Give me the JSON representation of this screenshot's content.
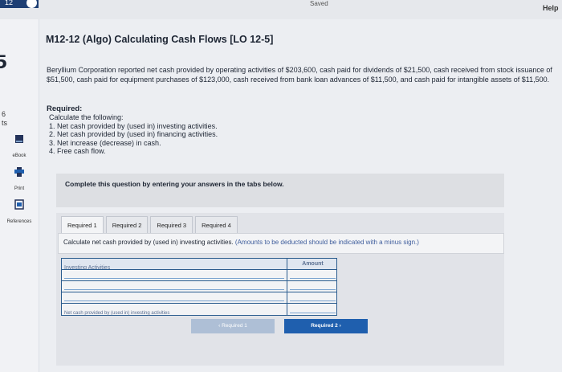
{
  "header": {
    "status": "Saved",
    "help": "Help",
    "corner_text": "12"
  },
  "sidebar": {
    "question_number": "5",
    "points_value": "6",
    "points_label": "ts",
    "items": [
      {
        "label": "eBook",
        "icon": "ebook-icon"
      },
      {
        "label": "Print",
        "icon": "printer-icon"
      },
      {
        "label": "References",
        "icon": "references-icon"
      }
    ]
  },
  "question": {
    "title": "M12-12 (Algo) Calculating Cash Flows [LO 12-5]",
    "body": "Beryllium Corporation reported net cash provided by operating activities of $203,600, cash paid for dividends of $21,500, cash received from stock issuance of $51,500, cash paid for equipment purchases of $123,000, cash received from bank loan advances of $11,500, and cash paid for intangible assets of $11,500.",
    "required_heading": "Required:",
    "required_intro": "Calculate the following:",
    "required_items": [
      "1. Net cash provided by (used in) investing activities.",
      "2. Net cash provided by (used in) financing activities.",
      "3. Net increase (decrease) in cash.",
      "4. Free cash flow."
    ]
  },
  "banner": {
    "text": "Complete this question by entering your answers in the tabs below."
  },
  "tabs": [
    {
      "label": "Required 1",
      "active": true
    },
    {
      "label": "Required 2",
      "active": false
    },
    {
      "label": "Required 3",
      "active": false
    },
    {
      "label": "Required 4",
      "active": false
    }
  ],
  "instructions": {
    "main": "Calculate net cash provided by (used in) investing activities.",
    "note": "(Amounts to be deducted should be indicated with a minus sign.)"
  },
  "table": {
    "header_label": "Investing Activities",
    "header_amount": "Amount",
    "rows": [
      {
        "label": "",
        "amount": ""
      },
      {
        "label": "",
        "amount": ""
      },
      {
        "label": "",
        "amount": ""
      }
    ],
    "total_label": "Net cash provided by (used in) investing activities",
    "total_amount": ""
  },
  "nav": {
    "prev_label": "Required 1",
    "next_label": "Required 2"
  },
  "colors": {
    "accent": "#1f5fae",
    "table_border": "#2b5c8e"
  }
}
